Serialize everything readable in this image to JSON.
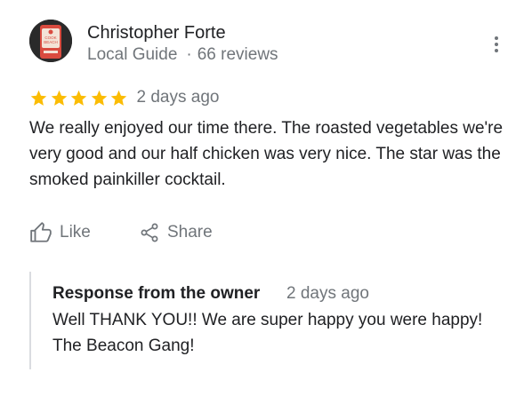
{
  "reviewer": {
    "name": "Christopher Forte",
    "badge": "Local Guide",
    "reviews_count": "66 reviews",
    "avatar_text": "COOK BEACH"
  },
  "rating": {
    "stars": 5,
    "max": 5,
    "date": "2 days ago",
    "star_color": "#fbbc04"
  },
  "review": {
    "text": "We really enjoyed our time there. The roasted vegetables we're very good and our half chicken was very nice. The star was the smoked painkiller cocktail."
  },
  "actions": {
    "like": "Like",
    "share": "Share"
  },
  "owner_response": {
    "title": "Response from the owner",
    "date": "2 days ago",
    "text": "Well THANK YOU!! We are super happy you were happy!  The Beacon Gang!"
  },
  "icons": {
    "more": "more-vert-icon",
    "like": "thumb-up-icon",
    "share": "share-icon",
    "star": "star-icon"
  },
  "colors": {
    "text": "#202124",
    "secondary": "#70757a",
    "divider": "#dadce0",
    "star": "#fbbc04"
  }
}
